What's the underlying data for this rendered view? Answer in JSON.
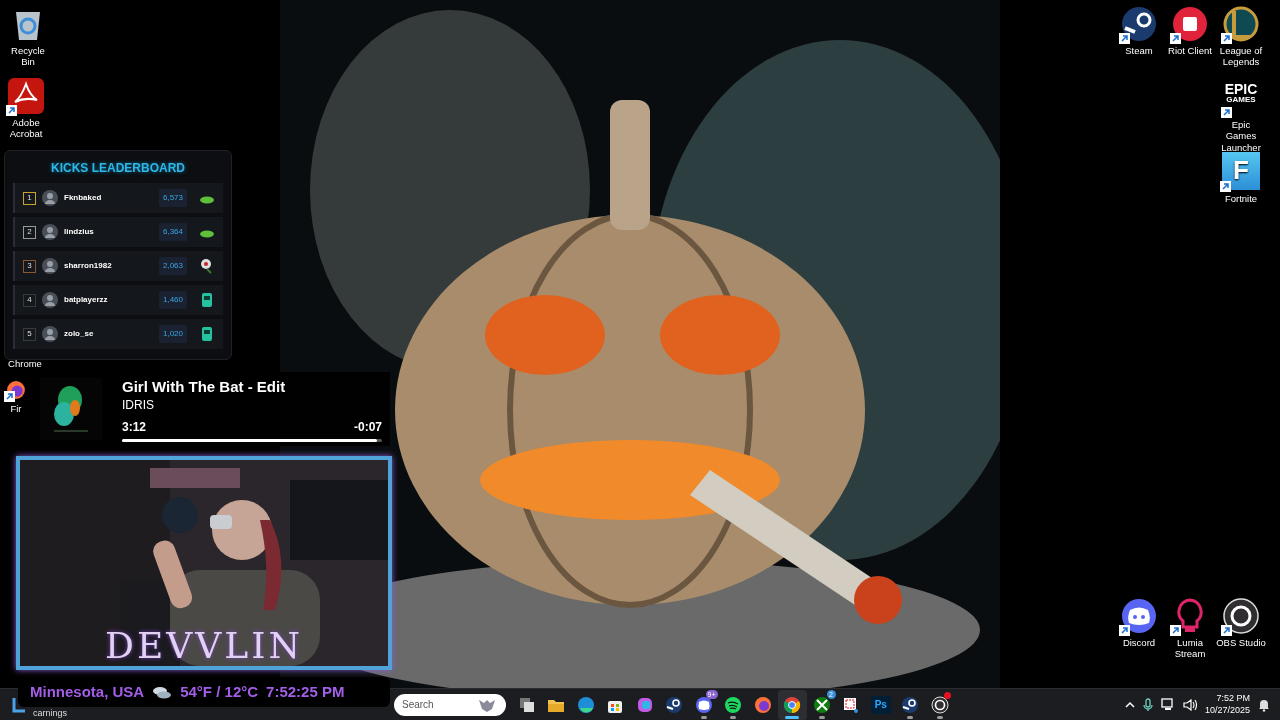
{
  "desktop": {
    "left_icons": [
      {
        "label": "Recycle Bin",
        "kind": "recycle",
        "shortcut": false
      },
      {
        "label": "Adobe Acrobat",
        "kind": "acrobat",
        "shortcut": true
      },
      {
        "label": "Chrome",
        "kind": "covered",
        "shortcut": false
      },
      {
        "label": "Fir",
        "kind": "firefox",
        "shortcut": true
      }
    ],
    "top_right_icons": [
      {
        "label": "Steam",
        "kind": "steam",
        "shortcut": true
      },
      {
        "label": "Riot Client",
        "kind": "riot",
        "shortcut": true
      },
      {
        "label": "League of Legends",
        "kind": "lol",
        "shortcut": true
      },
      {
        "label": "Epic Games Launcher",
        "kind": "epic",
        "shortcut": true,
        "logo_lines": [
          "EPIC",
          "GAMES"
        ]
      },
      {
        "label": "Fortnite",
        "kind": "fortnite",
        "shortcut": true,
        "logo_lines": [
          "F"
        ]
      }
    ],
    "bottom_right_icons": [
      {
        "label": "Discord",
        "kind": "discord",
        "shortcut": true
      },
      {
        "label": "Lumia Stream",
        "kind": "lumia",
        "shortcut": true
      },
      {
        "label": "OBS Studio",
        "kind": "obs",
        "shortcut": true
      }
    ]
  },
  "leaderboard": {
    "title": "KICKS LEADERBOARD",
    "rows": [
      {
        "rank": "1",
        "name": "Fknbaked",
        "score": "6,573",
        "color": "#c9a227",
        "kind": "shoe"
      },
      {
        "rank": "2",
        "name": "lindzius",
        "score": "6,364",
        "color": "#9a9a9a",
        "kind": "shoe"
      },
      {
        "rank": "3",
        "name": "sharron1982",
        "score": "2,063",
        "color": "#8a5a2e",
        "kind": "flower"
      },
      {
        "rank": "4",
        "name": "batplayerzz",
        "score": "1,460",
        "color": "#3a3a3a",
        "kind": "bot"
      },
      {
        "rank": "5",
        "name": "zolo_se",
        "score": "1,020",
        "color": "#3a3a3a",
        "kind": "bot"
      }
    ]
  },
  "now_playing": {
    "title": "Girl With The Bat - Edit",
    "artist": "IDRIS",
    "elapsed": "3:12",
    "remaining": "-0:07",
    "level": 0.98
  },
  "webcam": {
    "logo": "DEVVLIN"
  },
  "weather": {
    "location": "Minnesota, USA",
    "temperature": "54°F / 12°C",
    "time": "7:52:25 PM"
  },
  "taskbar": {
    "widget_label": "carnings",
    "search": {
      "placeholder": "Search"
    },
    "apps": [
      {
        "kind": "taskview",
        "running": false,
        "selected": false,
        "alert": false
      },
      {
        "kind": "folder",
        "running": false,
        "selected": false,
        "alert": false
      },
      {
        "kind": "edge",
        "running": false,
        "selected": false,
        "alert": false
      },
      {
        "kind": "store",
        "running": false,
        "selected": false,
        "alert": false
      },
      {
        "kind": "copilot",
        "running": false,
        "selected": false,
        "alert": false
      },
      {
        "kind": "steam",
        "running": false,
        "selected": false,
        "alert": false
      },
      {
        "kind": "discord",
        "running": true,
        "selected": false,
        "alert": false,
        "badge": "9+"
      },
      {
        "kind": "spotify",
        "running": true,
        "selected": false,
        "alert": false
      },
      {
        "kind": "firefox",
        "running": false,
        "selected": false,
        "alert": false
      },
      {
        "kind": "chrome",
        "running": true,
        "selected": true,
        "alert": false
      },
      {
        "kind": "xbox",
        "running": true,
        "selected": false,
        "alert": false,
        "badge": "2"
      },
      {
        "kind": "snip",
        "running": false,
        "selected": false,
        "alert": false
      },
      {
        "kind": "photoshop",
        "running": false,
        "selected": false,
        "alert": false,
        "logo_text": "Ps"
      },
      {
        "kind": "steam",
        "running": true,
        "selected": false,
        "alert": false
      },
      {
        "kind": "obs",
        "running": true,
        "selected": false,
        "alert": true
      }
    ],
    "tray": {
      "time": "7:52 PM",
      "date": "10/27/2025"
    }
  }
}
